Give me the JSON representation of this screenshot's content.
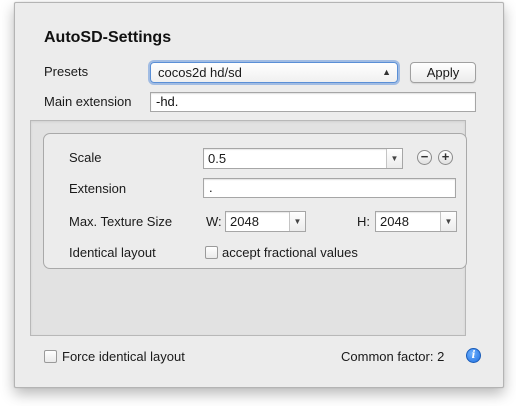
{
  "window": {
    "title": "AutoSD-Settings"
  },
  "presets": {
    "label": "Presets",
    "selected": "cocos2d hd/sd",
    "apply_label": "Apply"
  },
  "main_extension": {
    "label": "Main extension",
    "value": "-hd."
  },
  "variant": {
    "scale": {
      "label": "Scale",
      "value": "0.5"
    },
    "extension": {
      "label": "Extension",
      "value": "."
    },
    "max_texture": {
      "label": "Max. Texture Size",
      "w_label": "W:",
      "w_value": "2048",
      "h_label": "H:",
      "h_value": "2048"
    },
    "identical_layout": {
      "label": "Identical layout",
      "checkbox_label": "accept fractional values",
      "checked": false
    },
    "remove_symbol": "−",
    "add_symbol": "+"
  },
  "footer": {
    "force_label": "Force identical layout",
    "force_checked": false,
    "common_factor": "Common factor: 2",
    "info_symbol": "i"
  },
  "colors": {
    "accent": "#2f7de1",
    "focus_ring": "#6496dc"
  }
}
